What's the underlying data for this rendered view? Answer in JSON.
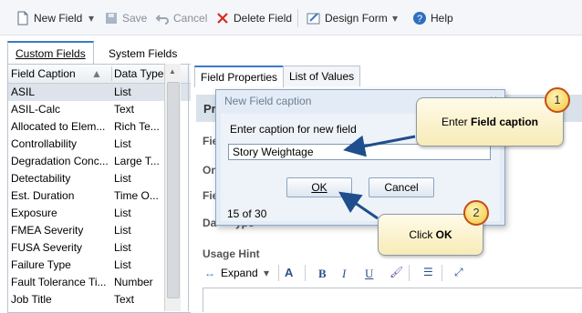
{
  "toolbar": {
    "new_field": "New Field",
    "save": "Save",
    "cancel": "Cancel",
    "delete_field": "Delete Field",
    "design_form": "Design Form",
    "help": "Help"
  },
  "left_tabs": [
    "Custom Fields",
    "System Fields"
  ],
  "grid": {
    "headers": [
      "Field Caption",
      "Data Type"
    ],
    "rows": [
      [
        "ASIL",
        "List"
      ],
      [
        "ASIL-Calc",
        "Text"
      ],
      [
        "Allocated to Elem...",
        "Rich Te..."
      ],
      [
        "Controllability",
        "List"
      ],
      [
        "Degradation Conc...",
        "Large T..."
      ],
      [
        "Detectability",
        "List"
      ],
      [
        "Est. Duration",
        "Time O..."
      ],
      [
        "Exposure",
        "List"
      ],
      [
        "FMEA Severity",
        "List"
      ],
      [
        "FUSA Severity",
        "List"
      ],
      [
        "Failure Type",
        "List"
      ],
      [
        "Fault Tolerance Ti...",
        "Number"
      ],
      [
        "Job Title",
        "Text"
      ]
    ]
  },
  "right_tabs": [
    "Field Properties",
    "List of Values"
  ],
  "right_labels": {
    "header": "Pr",
    "l1": "Fie",
    "l2": "Or",
    "l3": "Fie",
    "l4": "Da",
    "l4b": "ype",
    "usage_hint": "Usage Hint"
  },
  "editor": {
    "expand": "Expand"
  },
  "dialog": {
    "title": "New Field caption",
    "close": "×",
    "prompt": "Enter caption for new field",
    "value": "Story Weightage",
    "ok": "OK",
    "cancel": "Cancel",
    "count": "15 of 30"
  },
  "callouts": {
    "one_badge": "1",
    "one_text_a": "Enter ",
    "one_text_b": "Field caption",
    "two_badge": "2",
    "two_text_a": "Click ",
    "two_text_b": "OK"
  },
  "colors": {
    "accent": "#3b79c6",
    "arrow": "#1f4e8c",
    "badge_border": "#c44e17"
  }
}
